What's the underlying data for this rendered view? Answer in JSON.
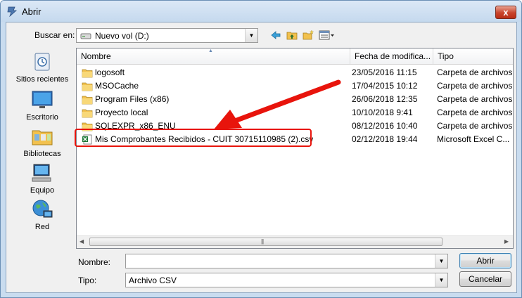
{
  "window": {
    "title": "Abrir",
    "close_label": "x"
  },
  "toolbar": {
    "look_in_label": "Buscar en:",
    "look_in_value": "Nuevo vol (D:)",
    "icons": [
      "back-icon",
      "up-folder-icon",
      "new-folder-icon",
      "view-menu-icon"
    ]
  },
  "places": [
    {
      "label": "Sitios recientes",
      "icon": "recent-places-icon"
    },
    {
      "label": "Escritorio",
      "icon": "desktop-icon"
    },
    {
      "label": "Bibliotecas",
      "icon": "libraries-icon"
    },
    {
      "label": "Equipo",
      "icon": "computer-icon"
    },
    {
      "label": "Red",
      "icon": "network-icon"
    }
  ],
  "columns": [
    "Nombre",
    "Fecha de modifica...",
    "Tipo"
  ],
  "files": [
    {
      "name": "logosoft",
      "date": "23/05/2016 11:15",
      "type": "Carpeta de archivos",
      "icon": "folder-icon"
    },
    {
      "name": "MSOCache",
      "date": "17/04/2015 10:12",
      "type": "Carpeta de archivos",
      "icon": "folder-icon"
    },
    {
      "name": "Program Files (x86)",
      "date": "26/06/2018 12:35",
      "type": "Carpeta de archivos",
      "icon": "folder-icon"
    },
    {
      "name": "Proyecto local",
      "date": "10/10/2018 9:41",
      "type": "Carpeta de archivos",
      "icon": "folder-icon"
    },
    {
      "name": "SQLEXPR_x86_ENU",
      "date": "08/12/2016 10:40",
      "type": "Carpeta de archivos",
      "icon": "folder-icon"
    },
    {
      "name": "Mis Comprobantes Recibidos - CUIT 30715110985 (2).csv",
      "date": "02/12/2018 19:44",
      "type": "Microsoft Excel C...",
      "icon": "excel-csv-icon"
    }
  ],
  "form": {
    "filename_label": "Nombre:",
    "filename_value": "",
    "filetype_label": "Tipo:",
    "filetype_value": "Archivo CSV",
    "open_button": "Abrir",
    "cancel_button": "Cancelar"
  },
  "colors": {
    "annotation": "#e8140c",
    "folder": "#f2c14e",
    "excel": "#1f7a3a"
  }
}
